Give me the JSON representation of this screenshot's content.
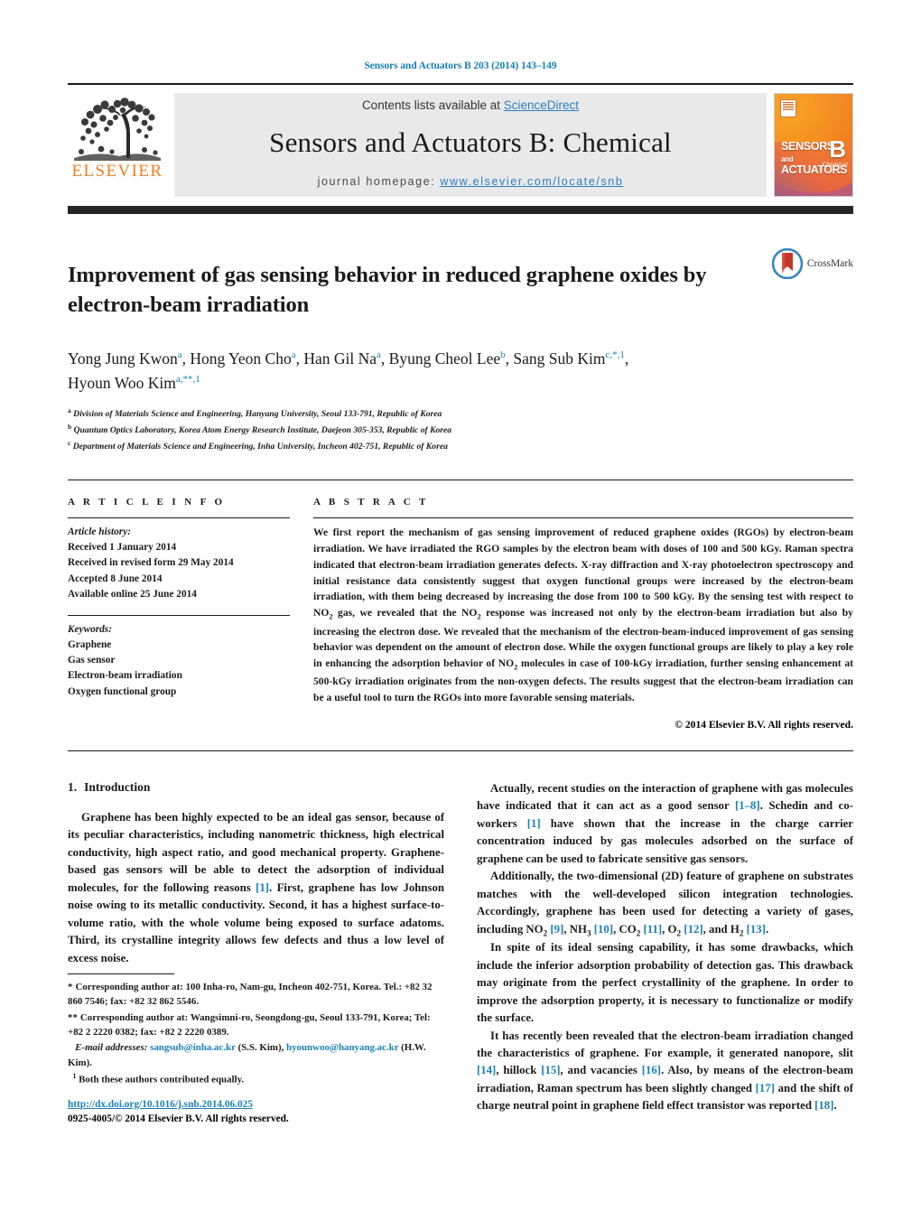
{
  "running_head": "Sensors and Actuators B 203 (2014) 143–149",
  "masthead": {
    "publisher_name": "ELSEVIER",
    "contents_prefix": "Contents lists available at ",
    "contents_link": "ScienceDirect",
    "journal_name": "Sensors and Actuators B: Chemical",
    "homepage_prefix": "journal homepage: ",
    "homepage_url": "www.elsevier.com/locate/snb",
    "cover": {
      "line1": "SENSORS",
      "line1_and": "and",
      "line2": "ACTUATORS",
      "letter": "B",
      "sub": "Chemical"
    }
  },
  "article": {
    "title": "Improvement of gas sensing behavior in reduced graphene oxides by electron-beam irradiation",
    "crossmark_label": "CrossMark",
    "authors_line1_parts": [
      {
        "name": "Yong Jung Kwon",
        "sup": "a",
        "sep": ", "
      },
      {
        "name": "Hong Yeon Cho",
        "sup": "a",
        "sep": ", "
      },
      {
        "name": "Han Gil Na",
        "sup": "a",
        "sep": ", "
      },
      {
        "name": "Byung Cheol Lee",
        "sup": "b",
        "sep": ", "
      },
      {
        "name": "Sang Sub Kim",
        "sup": "c,*,1",
        "sep": ","
      }
    ],
    "authors_line2": {
      "name": "Hyoun Woo Kim",
      "sup": "a,**,1"
    },
    "affiliations": [
      {
        "mark": "a",
        "text": "Division of Materials Science and Engineering, Hanyang University, Seoul 133-791, Republic of Korea"
      },
      {
        "mark": "b",
        "text": "Quantum Optics Laboratory, Korea Atom Energy Research Institute, Daejeon 305-353, Republic of Korea"
      },
      {
        "mark": "c",
        "text": "Department of Materials Science and Engineering, Inha University, Incheon 402-751, Republic of Korea"
      }
    ]
  },
  "article_info": {
    "heading": "A R T I C L E    I N F O",
    "history_label": "Article history:",
    "history": [
      "Received 1 January 2014",
      "Received in revised form 29 May 2014",
      "Accepted 8 June 2014",
      "Available online 25 June 2014"
    ],
    "keywords_label": "Keywords:",
    "keywords": [
      "Graphene",
      "Gas sensor",
      "Electron-beam irradiation",
      "Oxygen functional group"
    ]
  },
  "abstract": {
    "heading": "A B S T R A C T",
    "part1": "We first report the mechanism of gas sensing improvement of reduced graphene oxides (RGOs) by electron-beam irradiation. We have irradiated the RGO samples by the electron beam with doses of 100 and 500 kGy. Raman spectra indicated that electron-beam irradiation generates defects. X-ray diffraction and X-ray photoelectron spectroscopy and initial resistance data consistently suggest that oxygen functional groups were increased by the electron-beam irradiation, with them being decreased by increasing the dose from 100 to 500 kGy. By the sensing test with respect to NO",
    "sub1": "2",
    "part2": " gas, we revealed that the NO",
    "sub2": "2",
    "part3": " response was increased not only by the electron-beam irradiation but also by increasing the electron dose. We revealed that the mechanism of the electron-beam-induced improvement of gas sensing behavior was dependent on the amount of electron dose. While the oxygen functional groups are likely to play a key role in enhancing the adsorption behavior of NO",
    "sub3": "2",
    "part4": " molecules in case of 100-kGy irradiation, further sensing enhancement at 500-kGy irradiation originates from the non-oxygen defects. The results suggest that the electron-beam irradiation can be a useful tool to turn the RGOs into more favorable sensing materials.",
    "copyright": "© 2014 Elsevier B.V. All rights reserved."
  },
  "introduction": {
    "number": "1.",
    "heading": "Introduction",
    "p1_a": "Graphene has been highly expected to be an ideal gas sensor, because of its peculiar characteristics, including nanometric thickness, high electrical conductivity, high aspect ratio, and good mechanical property. Graphene-based gas sensors will be able to detect the adsorption of individual molecules, for the following reasons ",
    "p1_ref1": "[1]",
    "p1_b": ". First, graphene has low Johnson noise owing to its metallic conductivity. Second, it has a highest surface-to-volume ratio, with the whole volume being exposed to surface adatoms. Third, its crystalline integrity allows few defects and thus a low level of excess noise.",
    "p2_a": "Actually, recent studies on the interaction of graphene with gas molecules have indicated that it can act as a good sensor ",
    "p2_ref1": "[1–8]",
    "p2_b": ". Schedin and co-workers ",
    "p2_ref2": "[1]",
    "p2_c": " have shown that the increase in the charge carrier concentration induced by gas molecules adsorbed on the surface of graphene can be used to fabricate sensitive gas sensors.",
    "p3_a": "Additionally, the two-dimensional (2D) feature of graphene on substrates matches with the well-developed silicon integration technologies. Accordingly, graphene has been used for detecting a variety of gases, including NO",
    "p3_sub1": "2",
    "p3_ref1": "[9]",
    "p3_b": ", NH",
    "p3_sub2": "3",
    "p3_ref2": "[10]",
    "p3_c": ", CO",
    "p3_sub3": "2",
    "p3_ref3": "[11]",
    "p3_d": ", O",
    "p3_sub4": "2",
    "p3_ref4": "[12]",
    "p3_e": ", and H",
    "p3_sub5": "2",
    "p3_ref5": "[13]",
    "p3_f": ".",
    "p4": "In spite of its ideal sensing capability, it has some drawbacks, which include the inferior adsorption probability of detection gas. This drawback may originate from the perfect crystallinity of the graphene. In order to improve the adsorption property, it is necessary to functionalize or modify the surface.",
    "p5_a": "It has recently been revealed that the electron-beam irradiation changed the characteristics of graphene. For example, it generated nanopore, slit ",
    "p5_ref1": "[14]",
    "p5_b": ", hillock ",
    "p5_ref2": "[15]",
    "p5_c": ", and vacancies ",
    "p5_ref3": "[16]",
    "p5_d": ". Also, by means of the electron-beam irradiation, Raman spectrum has been slightly changed ",
    "p5_ref4": "[17]",
    "p5_e": " and the shift of charge neutral point in graphene field effect transistor was reported ",
    "p5_ref5": "[18]",
    "p5_f": "."
  },
  "footnotes": {
    "fn1_mark": "*",
    "fn1_text": "Corresponding author at: 100 Inha-ro, Nam-gu, Incheon 402-751, Korea. Tel.: +82 32 860 7546; fax: +82 32 862 5546.",
    "fn2_mark": "**",
    "fn2_text": "Corresponding author at: Wangsimni-ro, Seongdong-gu, Seoul 133-791, Korea; Tel: +82 2 2220 0382; fax: +82 2 2220 0389.",
    "email_label": "E-mail addresses:",
    "email1": "sangsub@inha.ac.kr",
    "email1_owner": "(S.S. Kim)",
    "email2": "hyounwoo@hanyang.ac.kr",
    "email2_owner": "(H.W. Kim).",
    "fn3_mark": "1",
    "fn3_text": "Both these authors contributed equally."
  },
  "footer": {
    "doi": "http://dx.doi.org/10.1016/j.snb.2014.06.025",
    "issn_line": "0925-4005/© 2014 Elsevier B.V. All rights reserved."
  },
  "colors": {
    "link": "#1a7fb5",
    "elsevier_orange": "#ef7d22",
    "band_gray": "#e9e9e9",
    "bar_dark": "#262626"
  }
}
